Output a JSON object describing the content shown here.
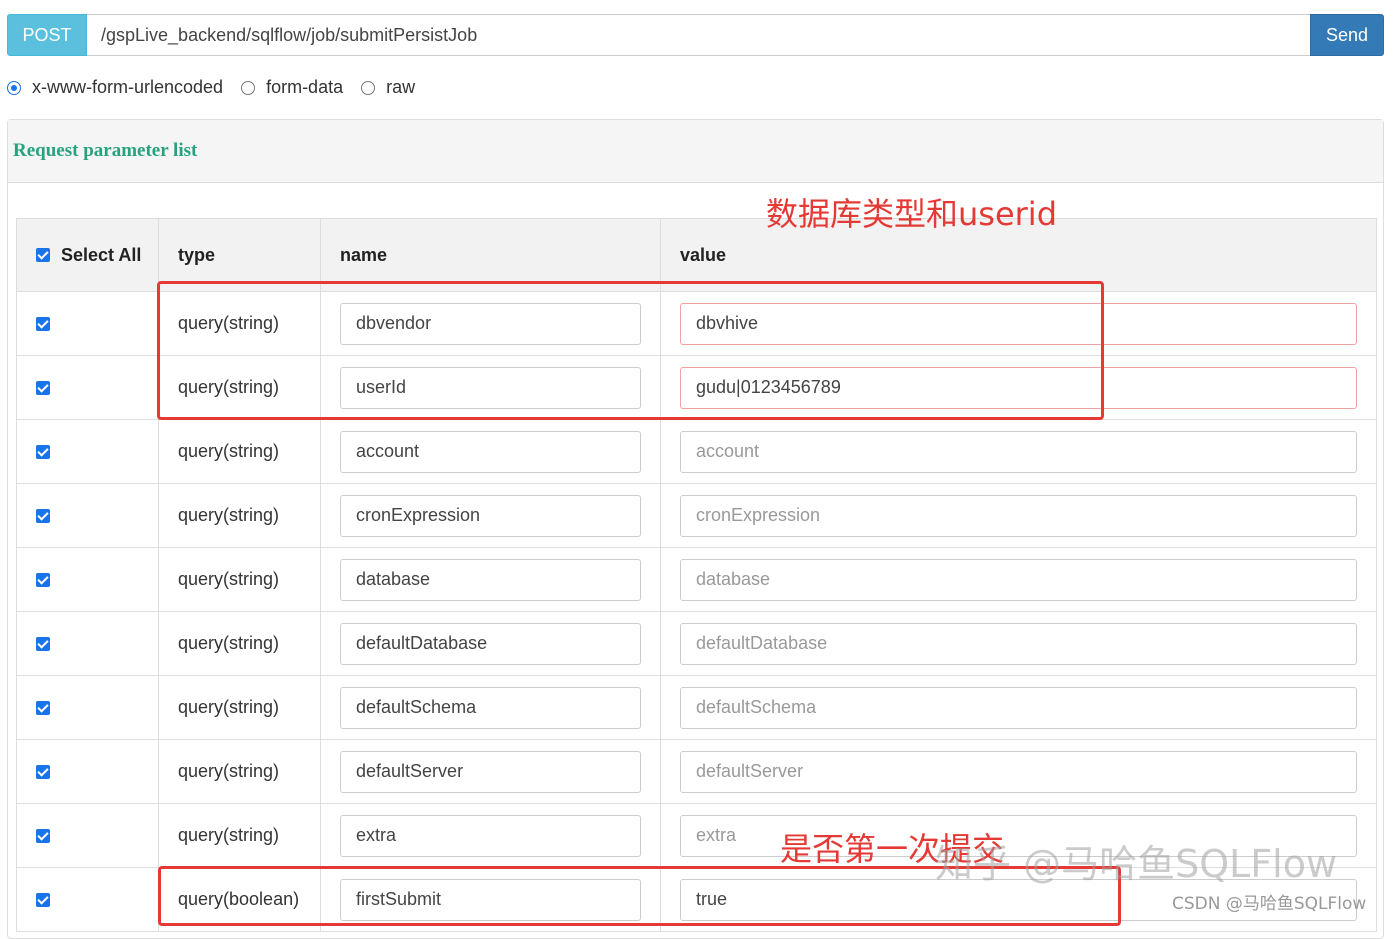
{
  "request": {
    "method": "POST",
    "url": "/gspLive_backend/sqlflow/job/submitPersistJob",
    "send_label": "Send"
  },
  "body_types": [
    {
      "label": "x-www-form-urlencoded",
      "selected": true
    },
    {
      "label": "form-data",
      "selected": false
    },
    {
      "label": "raw",
      "selected": false
    }
  ],
  "panel": {
    "title": "Request parameter list"
  },
  "table": {
    "headers": {
      "select_all": "Select All",
      "type": "type",
      "name": "name",
      "value": "value"
    },
    "rows": [
      {
        "type": "query(string)",
        "name": "dbvendor",
        "value": "dbvhive",
        "is_placeholder": false
      },
      {
        "type": "query(string)",
        "name": "userId",
        "value": "gudu|0123456789",
        "is_placeholder": false
      },
      {
        "type": "query(string)",
        "name": "account",
        "value": "account",
        "is_placeholder": true
      },
      {
        "type": "query(string)",
        "name": "cronExpression",
        "value": "cronExpression",
        "is_placeholder": true
      },
      {
        "type": "query(string)",
        "name": "database",
        "value": "database",
        "is_placeholder": true
      },
      {
        "type": "query(string)",
        "name": "defaultDatabase",
        "value": "defaultDatabase",
        "is_placeholder": true
      },
      {
        "type": "query(string)",
        "name": "defaultSchema",
        "value": "defaultSchema",
        "is_placeholder": true
      },
      {
        "type": "query(string)",
        "name": "defaultServer",
        "value": "defaultServer",
        "is_placeholder": true
      },
      {
        "type": "query(string)",
        "name": "extra",
        "value": "extra",
        "is_placeholder": true
      },
      {
        "type": "query(boolean)",
        "name": "firstSubmit",
        "value": "true",
        "is_placeholder": false
      }
    ]
  },
  "annotations": {
    "top": "数据库类型和userid",
    "bottom": "是否第一次提交"
  },
  "watermarks": {
    "zhihu": "知乎 @马哈鱼SQLFlow",
    "csdn": "CSDN @马哈鱼SQLFlow"
  },
  "colors": {
    "accent": "#27a27f",
    "annotation": "#e53935",
    "send": "#337ab7",
    "method": "#5bc0de"
  }
}
